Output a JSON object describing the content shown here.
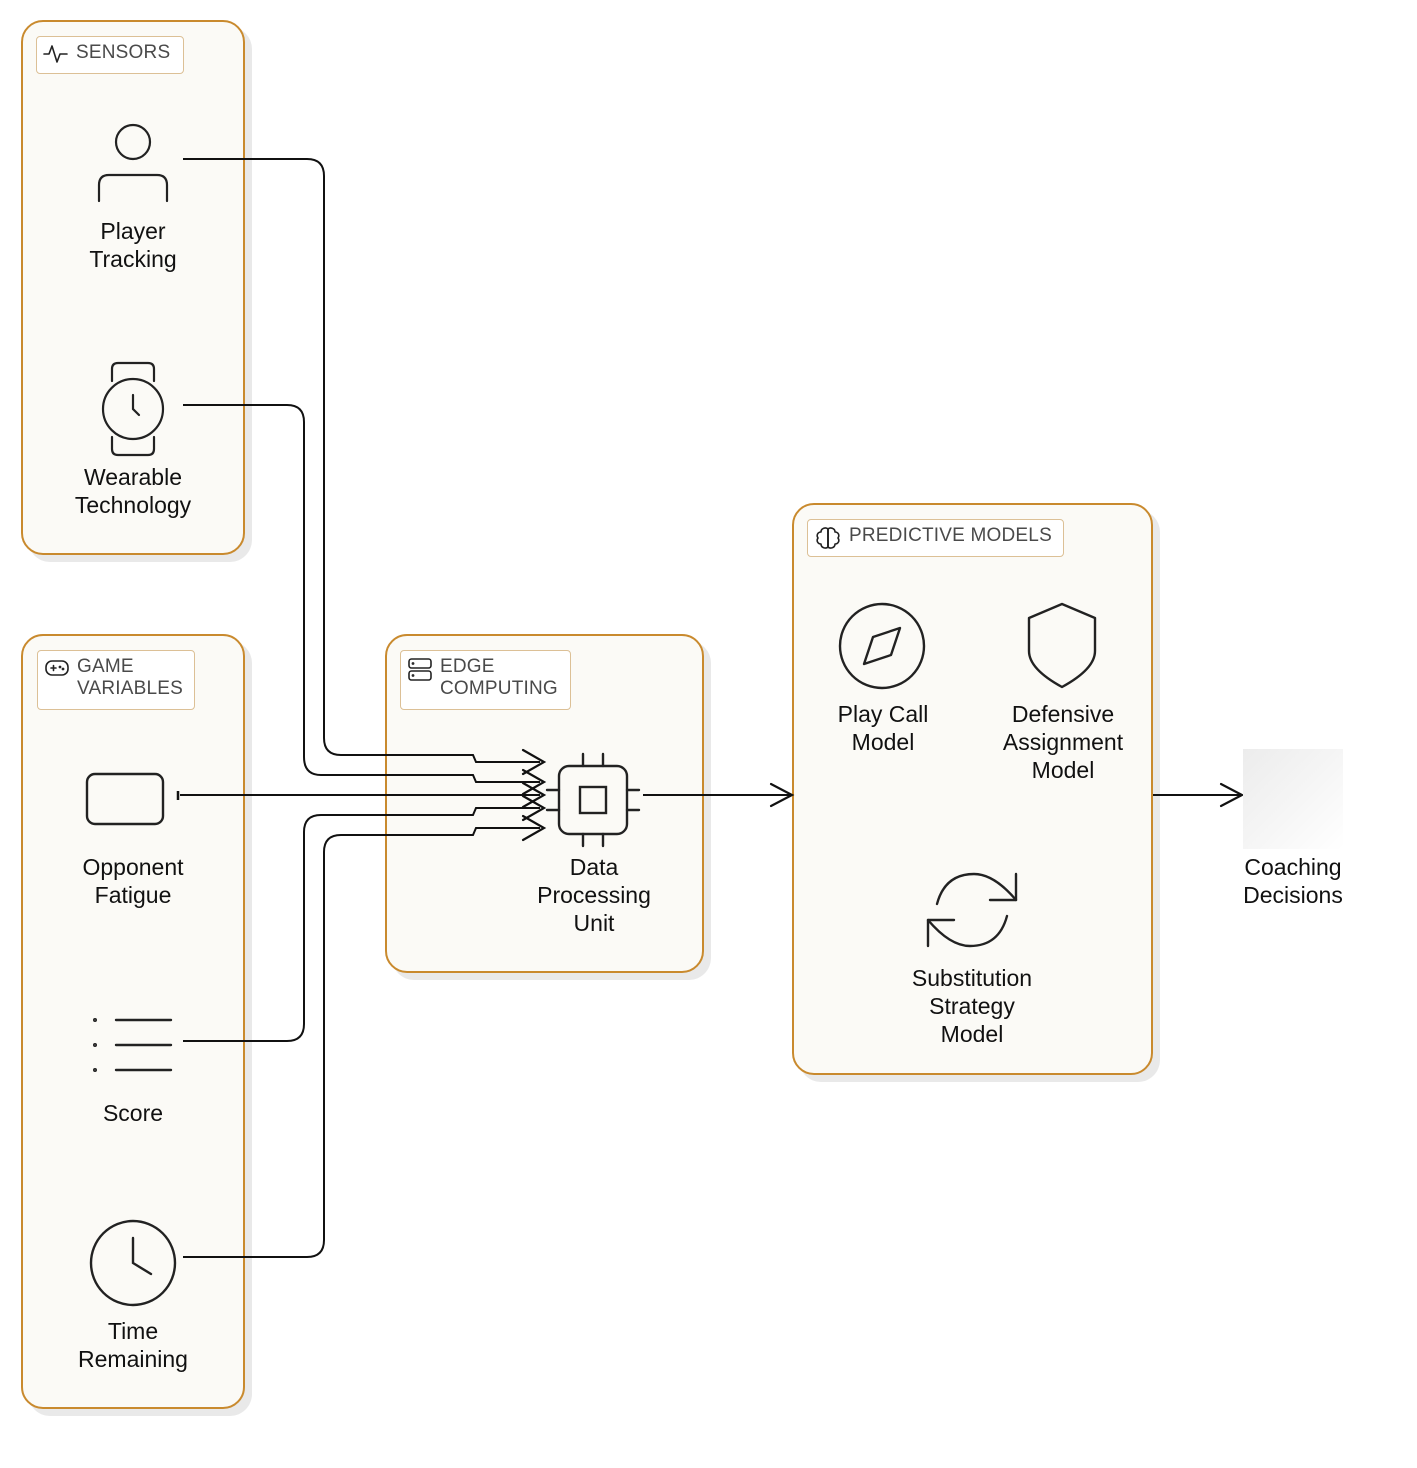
{
  "diagram": {
    "groups": {
      "sensors": {
        "title": "SENSORS",
        "icon": "activity-icon"
      },
      "game_variables": {
        "title": "GAME\nVARIABLES",
        "icon": "gamepad-icon"
      },
      "edge_computing": {
        "title": "EDGE\nCOMPUTING",
        "icon": "server-icon"
      },
      "predictive_models": {
        "title": "PREDICTIVE MODELS",
        "icon": "brain-icon"
      }
    },
    "nodes": {
      "player_tracking": {
        "label": "Player\nTracking",
        "icon": "user-icon"
      },
      "wearable_technology": {
        "label": "Wearable\nTechnology",
        "icon": "watch-icon"
      },
      "opponent_fatigue": {
        "label": "Opponent\nFatigue",
        "icon": "battery-icon"
      },
      "score": {
        "label": "Score",
        "icon": "list-icon"
      },
      "time_remaining": {
        "label": "Time\nRemaining",
        "icon": "clock-icon"
      },
      "data_processing_unit": {
        "label": "Data\nProcessing\nUnit",
        "icon": "cpu-icon"
      },
      "play_call_model": {
        "label": "Play Call\nModel",
        "icon": "compass-icon"
      },
      "defensive_assignment_model": {
        "label": "Defensive\nAssignment\nModel",
        "icon": "shield-icon"
      },
      "substitution_strategy_model": {
        "label": "Substitution\nStrategy\nModel",
        "icon": "refresh-icon"
      },
      "coaching_decisions": {
        "label": "Coaching\nDecisions",
        "icon": "blank-image"
      }
    },
    "edges": [
      {
        "from": "Player Tracking",
        "to": "Data Processing Unit"
      },
      {
        "from": "Wearable Technology",
        "to": "Data Processing Unit"
      },
      {
        "from": "Opponent Fatigue",
        "to": "Data Processing Unit"
      },
      {
        "from": "Score",
        "to": "Data Processing Unit"
      },
      {
        "from": "Time Remaining",
        "to": "Data Processing Unit"
      },
      {
        "from": "Data Processing Unit",
        "to": "Predictive Models"
      },
      {
        "from": "Predictive Models",
        "to": "Coaching Decisions"
      }
    ],
    "colors": {
      "group_border": "#c98a2e",
      "group_fill": "#fbfaf6",
      "badge_border": "#dcc096",
      "stroke": "#111111"
    }
  }
}
